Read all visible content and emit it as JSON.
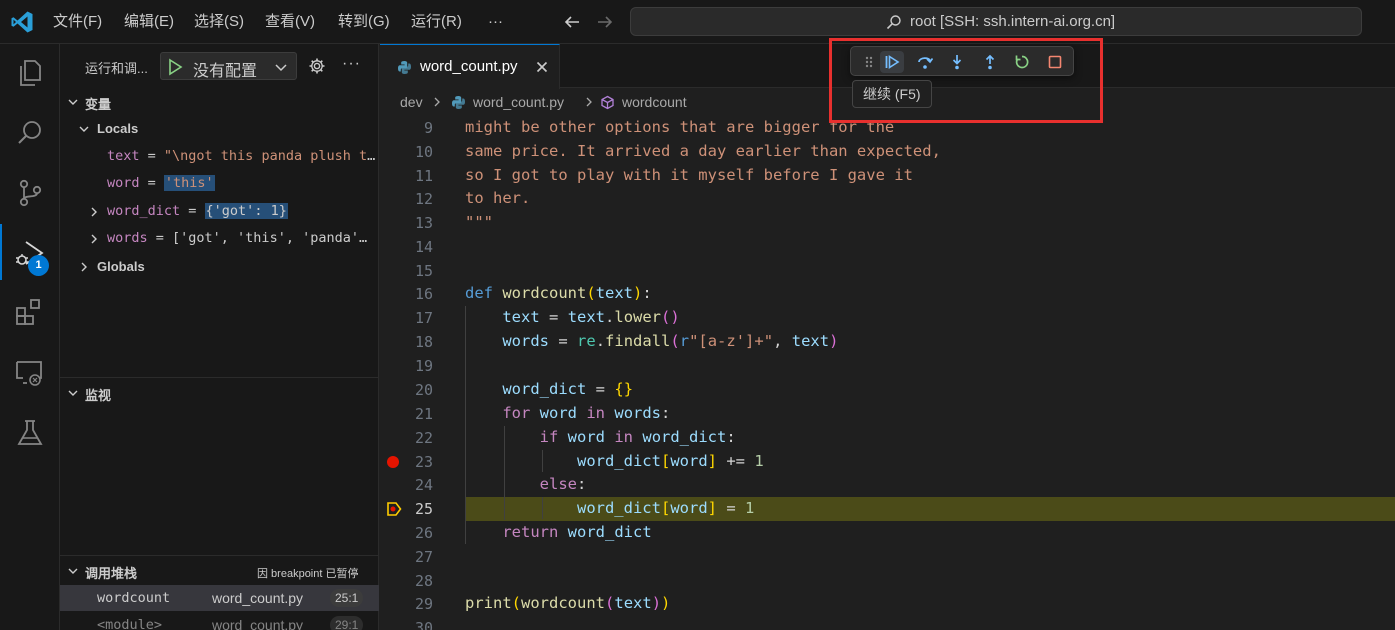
{
  "titlebar": {
    "menus": [
      "文件(F)",
      "编辑(E)",
      "选择(S)",
      "查看(V)",
      "转到(G)",
      "运行(R)",
      "···"
    ],
    "command_center": "root [SSH: ssh.intern-ai.org.cn]"
  },
  "activitybar": {
    "icons": [
      "explorer-icon",
      "search-icon",
      "source-control-icon",
      "run-debug-icon",
      "extensions-icon",
      "remote-explorer-icon",
      "testing-icon"
    ],
    "debug_badge": "1"
  },
  "sidebar": {
    "title": "运行和调...",
    "config_label": "没有配置",
    "variables": {
      "header": "变量",
      "locals_label": "Locals",
      "items": [
        {
          "name": "text",
          "value": "\"\\ngot this panda plush toy for my daughter's birthday,\\nwho loves it...\"",
          "expandable": false,
          "highlight": false
        },
        {
          "name": "word",
          "value": "'this'",
          "expandable": false,
          "highlight": true
        },
        {
          "name": "word_dict",
          "value": "{'got': 1}",
          "expandable": true,
          "highlight": true
        },
        {
          "name": "words",
          "value": "['got', 'this', 'panda', 'plush', 'toy']",
          "expandable": true,
          "highlight": false
        }
      ],
      "globals_label": "Globals"
    },
    "watch": {
      "header": "监视"
    },
    "callstack": {
      "header": "调用堆栈",
      "paused": "因 breakpoint 已暂停",
      "frames": [
        {
          "fn": "wordcount",
          "file": "word_count.py",
          "pos": "25:1"
        },
        {
          "fn": "<module>",
          "file": "word_count.py",
          "pos": "29:1"
        }
      ]
    }
  },
  "editor": {
    "tab_label": "word_count.py",
    "breadcrumbs": [
      "dev",
      "word_count.py",
      "wordcount"
    ],
    "tooltip": "继续 (F5)",
    "debug_toolbar": [
      "drag-handle-icon",
      "continue-icon",
      "step-over-icon",
      "step-into-icon",
      "step-out-icon",
      "restart-icon",
      "stop-icon"
    ],
    "breakpoint_line": 23,
    "current_line": 25,
    "line_numbers": [
      "9",
      "10",
      "11",
      "12",
      "13",
      "14",
      "15",
      "16",
      "17",
      "18",
      "19",
      "20",
      "21",
      "22",
      "23",
      "24",
      "25",
      "26",
      "27",
      "28",
      "29",
      "30"
    ]
  },
  "colors": {
    "accent": "#0078d4",
    "breakpoint": "#e51400",
    "annotation": "#e8302e",
    "current_line_bg": "#4b4b18"
  }
}
